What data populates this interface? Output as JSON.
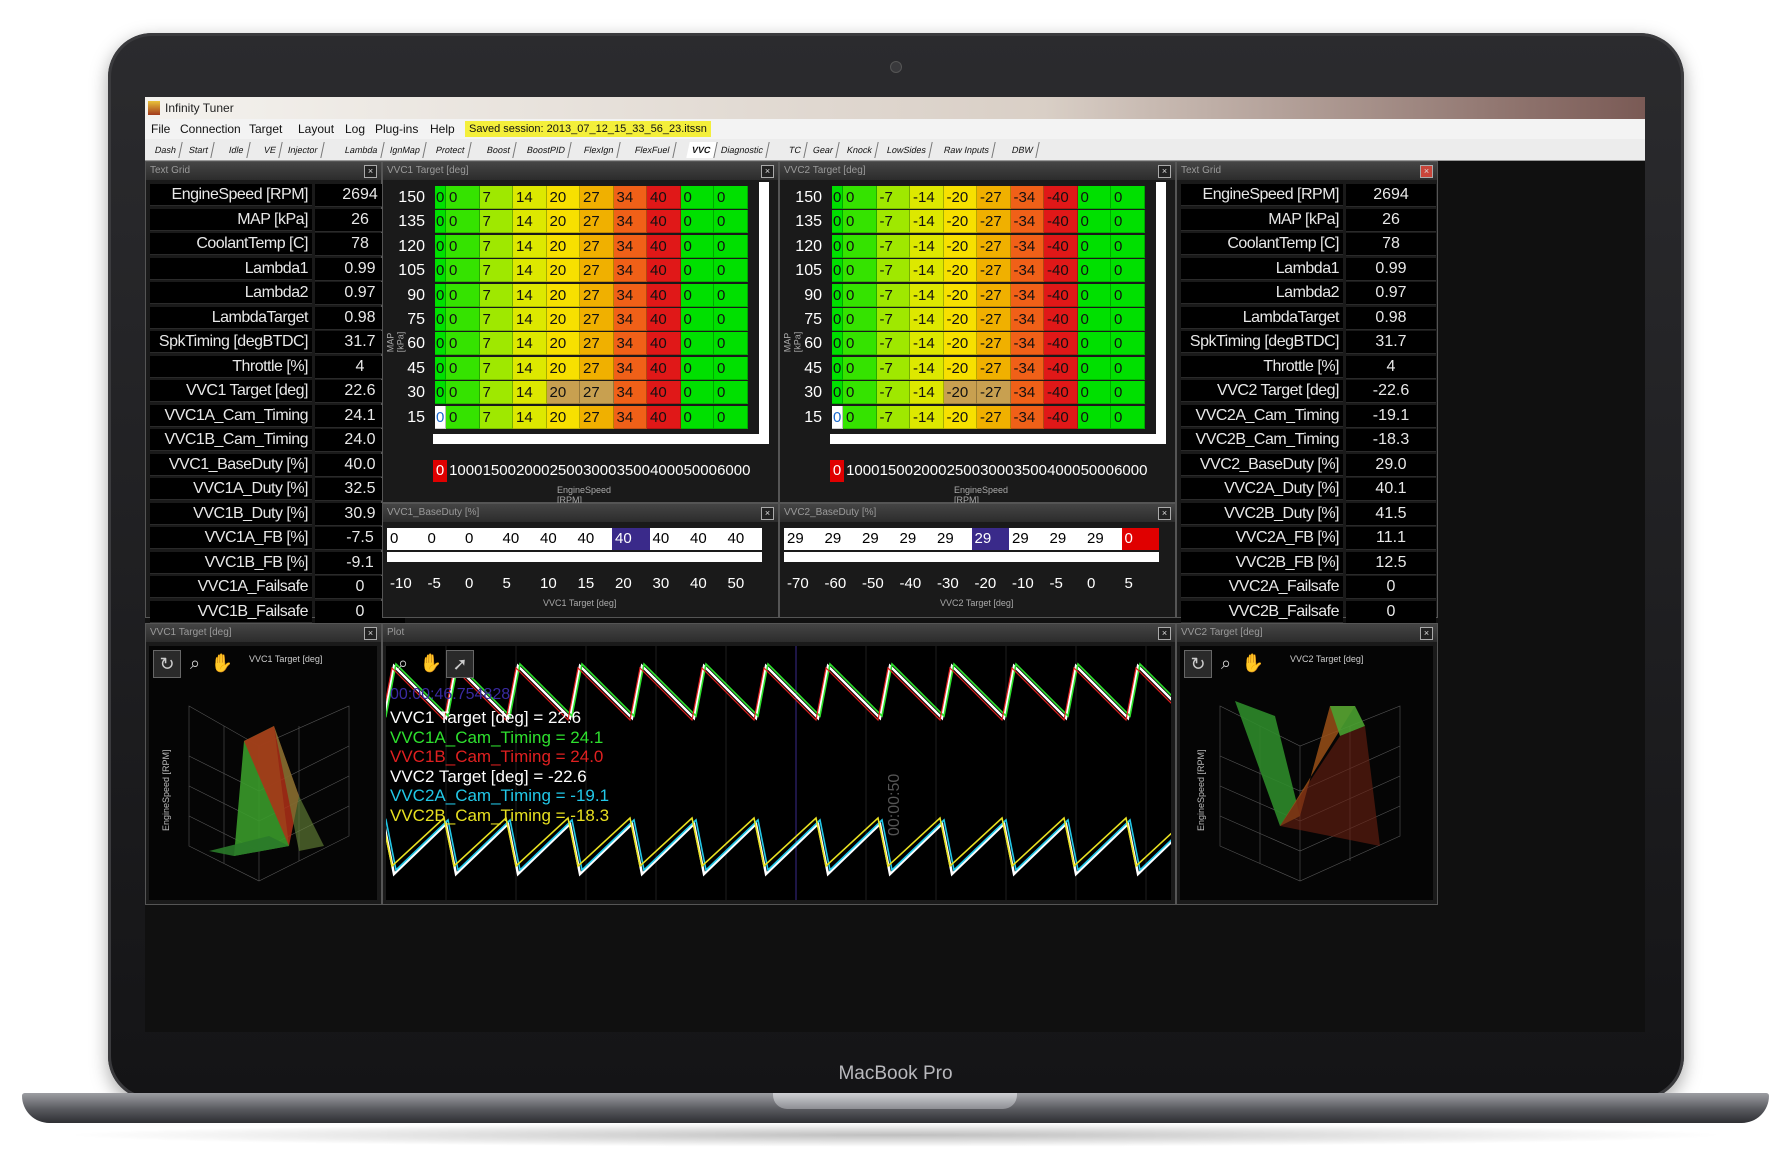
{
  "device": {
    "label": "MacBook Pro"
  },
  "window": {
    "title": "Infinity Tuner"
  },
  "menu": {
    "items": [
      "File",
      "Connection",
      "Target",
      "Layout",
      "Log",
      "Plug-ins",
      "Help"
    ],
    "session": "Saved session: 2013_07_12_15_33_56_23.itssn"
  },
  "tabs": [
    "Dash",
    "Start",
    "Idle",
    "VE",
    "Injector",
    "Lambda",
    "IgnMap",
    "Protect",
    "Boost",
    "BoostPID",
    "FlexIgn",
    "FlexFuel",
    "VVC",
    "Diagnostic",
    "TC",
    "Gear",
    "Knock",
    "LowSides",
    "Raw Inputs",
    "DBW"
  ],
  "active_tab": "VVC",
  "text_grid_left": {
    "title": "Text Grid",
    "rows": [
      {
        "name": "EngineSpeed [RPM]",
        "value": "2694"
      },
      {
        "name": "MAP [kPa]",
        "value": "26"
      },
      {
        "name": "CoolantTemp [C]",
        "value": "78"
      },
      {
        "name": "Lambda1",
        "value": "0.99"
      },
      {
        "name": "Lambda2",
        "value": "0.97"
      },
      {
        "name": "LambdaTarget",
        "value": "0.98"
      },
      {
        "name": "SpkTiming [degBTDC]",
        "value": "31.7"
      },
      {
        "name": "Throttle [%]",
        "value": "4"
      },
      {
        "name": "VVC1 Target [deg]",
        "value": "22.6"
      },
      {
        "name": "VVC1A_Cam_Timing",
        "value": "24.1"
      },
      {
        "name": "VVC1B_Cam_Timing",
        "value": "24.0"
      },
      {
        "name": "VVC1_BaseDuty [%]",
        "value": "40.0"
      },
      {
        "name": "VVC1A_Duty [%]",
        "value": "32.5"
      },
      {
        "name": "VVC1B_Duty [%]",
        "value": "30.9"
      },
      {
        "name": "VVC1A_FB [%]",
        "value": "-7.5"
      },
      {
        "name": "VVC1B_FB [%]",
        "value": "-9.1"
      },
      {
        "name": "VVC1A_Failsafe",
        "value": "0"
      },
      {
        "name": "VVC1B_Failsafe",
        "value": "0"
      }
    ]
  },
  "text_grid_right": {
    "title": "Text Grid",
    "rows": [
      {
        "name": "EngineSpeed [RPM]",
        "value": "2694"
      },
      {
        "name": "MAP [kPa]",
        "value": "26"
      },
      {
        "name": "CoolantTemp [C]",
        "value": "78"
      },
      {
        "name": "Lambda1",
        "value": "0.99"
      },
      {
        "name": "Lambda2",
        "value": "0.97"
      },
      {
        "name": "LambdaTarget",
        "value": "0.98"
      },
      {
        "name": "SpkTiming [degBTDC]",
        "value": "31.7"
      },
      {
        "name": "Throttle [%]",
        "value": "4"
      },
      {
        "name": "VVC2 Target [deg]",
        "value": "-22.6"
      },
      {
        "name": "VVC2A_Cam_Timing",
        "value": "-19.1"
      },
      {
        "name": "VVC2B_Cam_Timing",
        "value": "-18.3"
      },
      {
        "name": "VVC2_BaseDuty [%]",
        "value": "29.0"
      },
      {
        "name": "VVC2A_Duty [%]",
        "value": "40.1"
      },
      {
        "name": "VVC2B_Duty [%]",
        "value": "41.5"
      },
      {
        "name": "VVC2A_FB [%]",
        "value": "11.1"
      },
      {
        "name": "VVC2B_FB [%]",
        "value": "12.5"
      },
      {
        "name": "VVC2A_Failsafe",
        "value": "0"
      },
      {
        "name": "VVC2B_Failsafe",
        "value": "0"
      }
    ]
  },
  "vvc1_map": {
    "title": "VVC1 Target [deg]",
    "ylabel": "MAP [kPa]",
    "xlabel": "EngineSpeed [RPM]",
    "y": [
      "150",
      "135",
      "120",
      "105",
      "90",
      "75",
      "60",
      "45",
      "30",
      "15"
    ],
    "x": [
      "0",
      "1000",
      "1500",
      "2000",
      "2500",
      "3000",
      "3500",
      "4000",
      "5000",
      "6000"
    ],
    "row": [
      "0",
      "0",
      "7",
      "14",
      "20",
      "27",
      "34",
      "40",
      "0",
      "0"
    ],
    "colors": [
      "#00e000",
      "#35e300",
      "#9fe800",
      "#dde800",
      "#f7e000",
      "#f0b000",
      "#f06018",
      "#e01818",
      "#00e000",
      "#00e000"
    ]
  },
  "vvc2_map": {
    "title": "VVC2 Target [deg]",
    "ylabel": "MAP [kPa]",
    "xlabel": "EngineSpeed [RPM]",
    "y": [
      "150",
      "135",
      "120",
      "105",
      "90",
      "75",
      "60",
      "45",
      "30",
      "15"
    ],
    "x": [
      "0",
      "1000",
      "1500",
      "2000",
      "2500",
      "3000",
      "3500",
      "4000",
      "5000",
      "6000"
    ],
    "row": [
      "0",
      "0",
      "-7",
      "-14",
      "-20",
      "-27",
      "-34",
      "-40",
      "0",
      "0"
    ],
    "colors": [
      "#00e000",
      "#35e300",
      "#9fe800",
      "#dde800",
      "#f7e000",
      "#f0b000",
      "#f06018",
      "#e01818",
      "#00e000",
      "#00e000"
    ]
  },
  "vvc1_duty": {
    "title": "VVC1_BaseDuty [%]",
    "values": [
      "0",
      "0",
      "0",
      "40",
      "40",
      "40",
      "40",
      "40",
      "40",
      "40"
    ],
    "axis": [
      "-10",
      "-5",
      "0",
      "5",
      "10",
      "15",
      "20",
      "30",
      "40",
      "50"
    ],
    "xlabel": "VVC1 Target [deg]"
  },
  "vvc2_duty": {
    "title": "VVC2_BaseDuty [%]",
    "values": [
      "29",
      "29",
      "29",
      "29",
      "29",
      "29",
      "29",
      "29",
      "29",
      "0"
    ],
    "axis": [
      "-70",
      "-60",
      "-50",
      "-40",
      "-30",
      "-20",
      "-10",
      "-5",
      "0",
      "5"
    ],
    "xlabel": "VVC2 Target [deg]"
  },
  "surface_left": {
    "title": "VVC1 Target [deg]",
    "inner_title": "VVC1 Target [deg]",
    "axis": "EngineSpeed [RPM]"
  },
  "surface_right": {
    "title": "VVC2 Target [deg]",
    "inner_title": "VVC2 Target [deg]",
    "axis": "EngineSpeed [RPM]"
  },
  "plot": {
    "title": "Plot",
    "time": "00:00:46.754828",
    "time_vertical": "00:00:50",
    "legend": [
      {
        "label": "VVC1 Target [deg] = 22.6",
        "color": "#ffffff"
      },
      {
        "label": "VVC1A_Cam_Timing = 24.1",
        "color": "#2ee02e"
      },
      {
        "label": "VVC1B_Cam_Timing = 24.0",
        "color": "#e02020"
      },
      {
        "label": "VVC2 Target [deg] = -22.6",
        "color": "#ffffff"
      },
      {
        "label": "VVC2A_Cam_Timing = -19.1",
        "color": "#22c8e8"
      },
      {
        "label": "VVC2B_Cam_Timing = -18.3",
        "color": "#e8e020"
      }
    ]
  },
  "colors": {
    "selected_cell": "#3a2a8a",
    "cursor_cell": "#e00000",
    "highlight_cell": "#c8a050"
  }
}
